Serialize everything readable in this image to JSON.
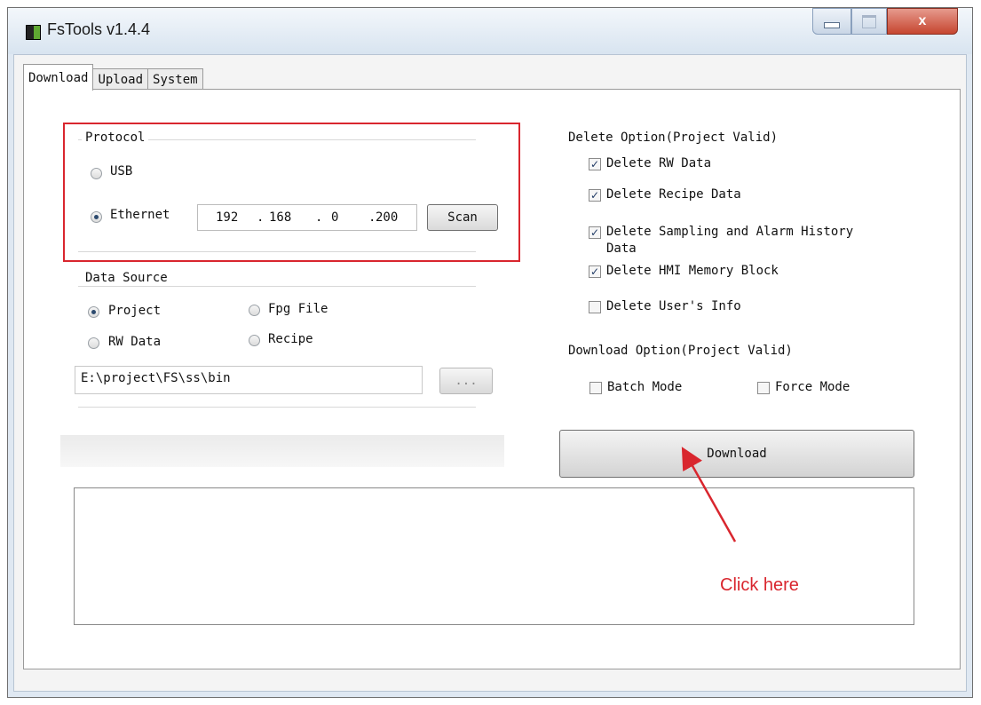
{
  "window": {
    "title": "FsTools v1.4.4",
    "close_glyph": "x"
  },
  "tabs": [
    {
      "label": "Download",
      "active": true
    },
    {
      "label": "Upload",
      "active": false
    },
    {
      "label": "System",
      "active": false
    }
  ],
  "protocol": {
    "title": "Protocol",
    "usb_label": "USB",
    "ethernet_label": "Ethernet",
    "selected": "Ethernet",
    "ip": [
      "192",
      "168",
      "0",
      "200"
    ],
    "ip_dots": ".",
    "scan_label": "Scan"
  },
  "data_source": {
    "title": "Data Source",
    "options": [
      "Project",
      "Fpg File",
      "RW Data",
      "Recipe"
    ],
    "selected": "Project",
    "path": "E:\\project\\FS\\ss\\bin",
    "browse_label": "..."
  },
  "delete_option": {
    "title": "Delete Option(Project Valid)",
    "items": [
      {
        "label": "Delete RW Data",
        "checked": true
      },
      {
        "label": "Delete Recipe Data",
        "checked": true
      },
      {
        "label": "Delete Sampling and Alarm History",
        "label2": "Data",
        "checked": true
      },
      {
        "label": "Delete HMI Memory Block",
        "checked": true
      },
      {
        "label": "Delete User's Info",
        "checked": false
      }
    ]
  },
  "download_option": {
    "title": "Download Option(Project Valid)",
    "batch_label": "Batch Mode",
    "force_label": "Force Mode",
    "batch_checked": false,
    "force_checked": false
  },
  "download_button": {
    "label": "Download"
  },
  "annotation": {
    "text": "Click here",
    "color": "#d9262e"
  },
  "check_glyph": "✓"
}
